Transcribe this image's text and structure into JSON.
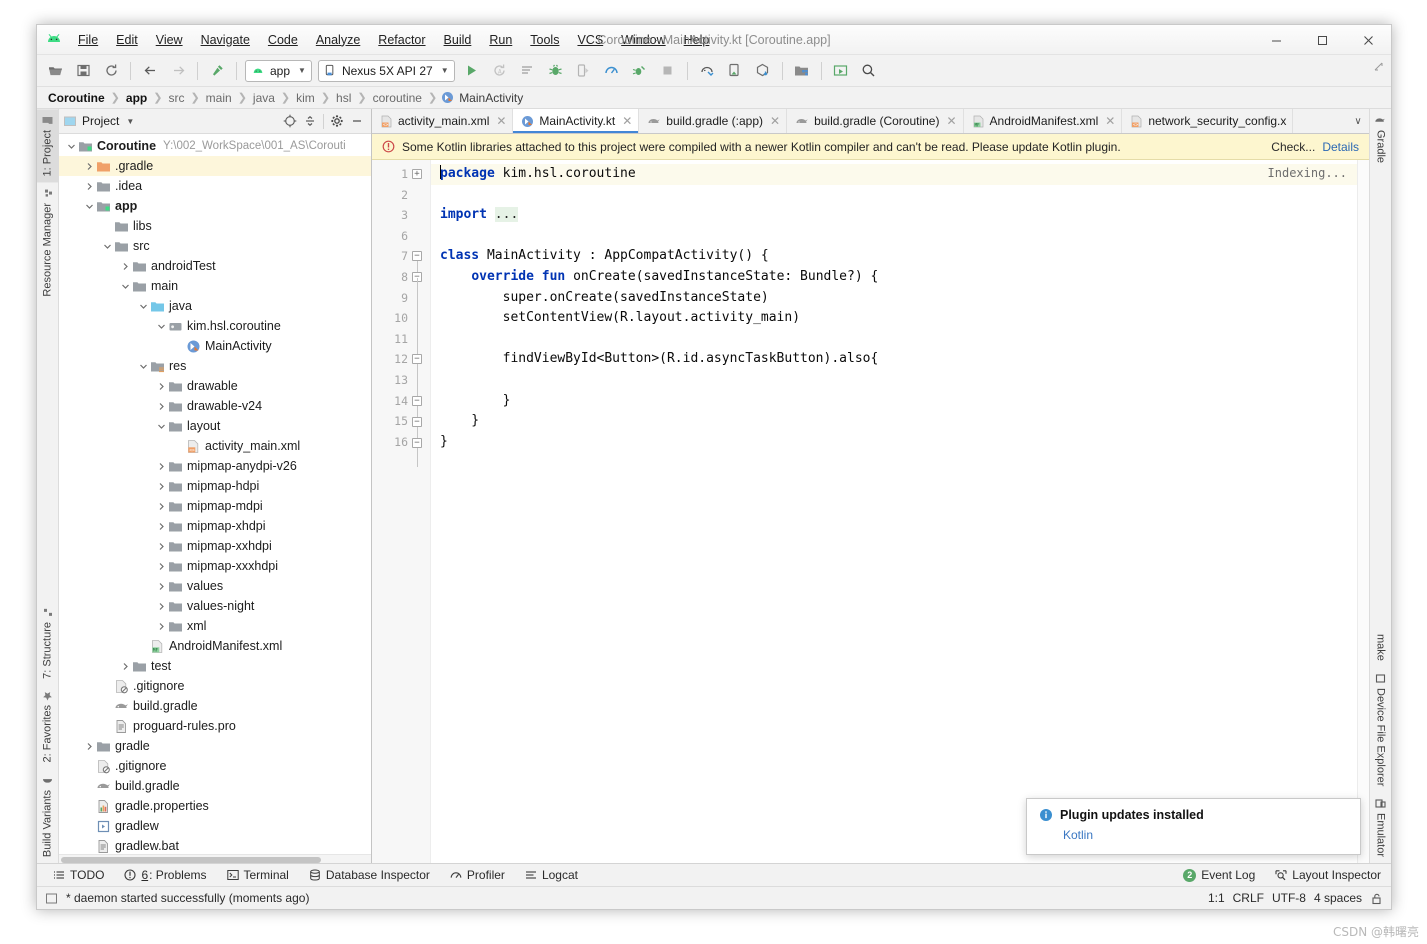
{
  "window": {
    "title": "Coroutine - MainActivity.kt [Coroutine.app]",
    "minimize": "─",
    "maximize": "☐",
    "close": "✕"
  },
  "menubar": [
    {
      "label": "File"
    },
    {
      "label": "Edit"
    },
    {
      "label": "View"
    },
    {
      "label": "Navigate"
    },
    {
      "label": "Code"
    },
    {
      "label": "Analyze"
    },
    {
      "label": "Refactor"
    },
    {
      "label": "Build"
    },
    {
      "label": "Run"
    },
    {
      "label": "Tools"
    },
    {
      "label": "VCS"
    },
    {
      "label": "Window"
    },
    {
      "label": "Help"
    }
  ],
  "toolbar": {
    "module_selector": "app",
    "device_selector": "Nexus 5X API 27",
    "icons": [
      "open-folder-icon",
      "save-all-icon",
      "sync-icon",
      "back-arrow-icon",
      "forward-arrow-icon",
      "build-hammer-icon",
      "run-icon",
      "apply-changes-icon",
      "apply-code-changes-icon",
      "debug-icon",
      "attach-debugger-icon",
      "profiler-icon",
      "run-with-coverage-icon",
      "stop-icon",
      "sdk-manager-icon",
      "avd-manager-icon",
      "sync-project-icon",
      "project-structure-icon",
      "device-manager-icon",
      "search-icon"
    ]
  },
  "breadcrumb": [
    {
      "label": "Coroutine",
      "style": "bold"
    },
    {
      "label": "app",
      "style": "bold"
    },
    {
      "label": "src",
      "style": "dim"
    },
    {
      "label": "main",
      "style": "dim"
    },
    {
      "label": "java",
      "style": "dim"
    },
    {
      "label": "kim",
      "style": "dim"
    },
    {
      "label": "hsl",
      "style": "dim"
    },
    {
      "label": "coroutine",
      "style": "dim"
    },
    {
      "label": "MainActivity",
      "style": "plain",
      "icon": "kotlin-class-icon"
    }
  ],
  "left_strip": {
    "top": [
      {
        "label": "1: Project",
        "icon": "project-icon",
        "active": true
      },
      {
        "label": "Resource Manager",
        "icon": "resource-manager-icon",
        "active": false
      }
    ],
    "bottom": [
      {
        "label": "7: Structure",
        "icon": "structure-icon"
      },
      {
        "label": "2: Favorites",
        "icon": "star-icon"
      },
      {
        "label": "Build Variants",
        "icon": "build-variants-icon"
      }
    ]
  },
  "right_strip": {
    "top": [
      {
        "label": "Gradle",
        "icon": "gradle-elephant-icon"
      }
    ],
    "bottom": [
      {
        "label": "make",
        "icon": ""
      },
      {
        "label": "Device File Explorer",
        "icon": "device-file-explorer-icon"
      },
      {
        "label": "Emulator",
        "icon": "emulator-icon"
      }
    ]
  },
  "project_panel": {
    "title": "Project",
    "header_icons": [
      "target-icon",
      "collapse-all-icon",
      "gear-icon",
      "hide-icon"
    ],
    "tree": [
      {
        "depth": 0,
        "arrow": "down",
        "icon": "module-folder-icon",
        "label": "Coroutine",
        "bold": true,
        "path": "Y:\\002_WorkSpace\\001_AS\\Corouti",
        "selected": false
      },
      {
        "depth": 1,
        "arrow": "right",
        "icon": "excluded-folder-icon",
        "label": ".gradle",
        "bold": false,
        "path": "",
        "selected": true
      },
      {
        "depth": 1,
        "arrow": "right",
        "icon": "folder-icon",
        "label": ".idea",
        "bold": false,
        "path": "",
        "selected": false
      },
      {
        "depth": 1,
        "arrow": "down",
        "icon": "module-folder-icon",
        "label": "app",
        "bold": true,
        "path": "",
        "selected": false
      },
      {
        "depth": 2,
        "arrow": "none",
        "icon": "folder-icon",
        "label": "libs",
        "bold": false,
        "path": "",
        "selected": false
      },
      {
        "depth": 2,
        "arrow": "down",
        "icon": "folder-icon",
        "label": "src",
        "bold": false,
        "path": "",
        "selected": false
      },
      {
        "depth": 3,
        "arrow": "right",
        "icon": "folder-icon",
        "label": "androidTest",
        "bold": false,
        "path": "",
        "selected": false
      },
      {
        "depth": 3,
        "arrow": "down",
        "icon": "folder-icon",
        "label": "main",
        "bold": false,
        "path": "",
        "selected": false
      },
      {
        "depth": 4,
        "arrow": "down",
        "icon": "source-folder-icon",
        "label": "java",
        "bold": false,
        "path": "",
        "selected": false
      },
      {
        "depth": 5,
        "arrow": "down",
        "icon": "package-icon",
        "label": "kim.hsl.coroutine",
        "bold": false,
        "path": "",
        "selected": false
      },
      {
        "depth": 6,
        "arrow": "none",
        "icon": "kotlin-class-icon",
        "label": "MainActivity",
        "bold": false,
        "path": "",
        "selected": false
      },
      {
        "depth": 4,
        "arrow": "down",
        "icon": "res-folder-icon",
        "label": "res",
        "bold": false,
        "path": "",
        "selected": false
      },
      {
        "depth": 5,
        "arrow": "right",
        "icon": "folder-icon",
        "label": "drawable",
        "bold": false,
        "path": "",
        "selected": false
      },
      {
        "depth": 5,
        "arrow": "right",
        "icon": "folder-icon",
        "label": "drawable-v24",
        "bold": false,
        "path": "",
        "selected": false
      },
      {
        "depth": 5,
        "arrow": "down",
        "icon": "folder-icon",
        "label": "layout",
        "bold": false,
        "path": "",
        "selected": false
      },
      {
        "depth": 6,
        "arrow": "none",
        "icon": "layout-xml-icon",
        "label": "activity_main.xml",
        "bold": false,
        "path": "",
        "selected": false
      },
      {
        "depth": 5,
        "arrow": "right",
        "icon": "folder-icon",
        "label": "mipmap-anydpi-v26",
        "bold": false,
        "path": "",
        "selected": false
      },
      {
        "depth": 5,
        "arrow": "right",
        "icon": "folder-icon",
        "label": "mipmap-hdpi",
        "bold": false,
        "path": "",
        "selected": false
      },
      {
        "depth": 5,
        "arrow": "right",
        "icon": "folder-icon",
        "label": "mipmap-mdpi",
        "bold": false,
        "path": "",
        "selected": false
      },
      {
        "depth": 5,
        "arrow": "right",
        "icon": "folder-icon",
        "label": "mipmap-xhdpi",
        "bold": false,
        "path": "",
        "selected": false
      },
      {
        "depth": 5,
        "arrow": "right",
        "icon": "folder-icon",
        "label": "mipmap-xxhdpi",
        "bold": false,
        "path": "",
        "selected": false
      },
      {
        "depth": 5,
        "arrow": "right",
        "icon": "folder-icon",
        "label": "mipmap-xxxhdpi",
        "bold": false,
        "path": "",
        "selected": false
      },
      {
        "depth": 5,
        "arrow": "right",
        "icon": "folder-icon",
        "label": "values",
        "bold": false,
        "path": "",
        "selected": false
      },
      {
        "depth": 5,
        "arrow": "right",
        "icon": "folder-icon",
        "label": "values-night",
        "bold": false,
        "path": "",
        "selected": false
      },
      {
        "depth": 5,
        "arrow": "right",
        "icon": "folder-icon",
        "label": "xml",
        "bold": false,
        "path": "",
        "selected": false
      },
      {
        "depth": 4,
        "arrow": "none",
        "icon": "manifest-xml-icon",
        "label": "AndroidManifest.xml",
        "bold": false,
        "path": "",
        "selected": false
      },
      {
        "depth": 3,
        "arrow": "right",
        "icon": "folder-icon",
        "label": "test",
        "bold": false,
        "path": "",
        "selected": false
      },
      {
        "depth": 2,
        "arrow": "none",
        "icon": "gitignore-icon",
        "label": ".gitignore",
        "bold": false,
        "path": "",
        "selected": false
      },
      {
        "depth": 2,
        "arrow": "none",
        "icon": "gradle-file-icon",
        "label": "build.gradle",
        "bold": false,
        "path": "",
        "selected": false
      },
      {
        "depth": 2,
        "arrow": "none",
        "icon": "text-file-icon",
        "label": "proguard-rules.pro",
        "bold": false,
        "path": "",
        "selected": false
      },
      {
        "depth": 1,
        "arrow": "right",
        "icon": "folder-icon",
        "label": "gradle",
        "bold": false,
        "path": "",
        "selected": false
      },
      {
        "depth": 1,
        "arrow": "none",
        "icon": "gitignore-icon",
        "label": ".gitignore",
        "bold": false,
        "path": "",
        "selected": false
      },
      {
        "depth": 1,
        "arrow": "none",
        "icon": "gradle-file-icon",
        "label": "build.gradle",
        "bold": false,
        "path": "",
        "selected": false
      },
      {
        "depth": 1,
        "arrow": "none",
        "icon": "properties-icon",
        "label": "gradle.properties",
        "bold": false,
        "path": "",
        "selected": false
      },
      {
        "depth": 1,
        "arrow": "none",
        "icon": "script-icon",
        "label": "gradlew",
        "bold": false,
        "path": "",
        "selected": false
      },
      {
        "depth": 1,
        "arrow": "none",
        "icon": "text-file-icon",
        "label": "gradlew.bat",
        "bold": false,
        "path": "",
        "selected": false
      }
    ]
  },
  "editor": {
    "tabs": [
      {
        "label": "activity_main.xml",
        "icon": "layout-xml-icon",
        "active": false
      },
      {
        "label": "MainActivity.kt",
        "icon": "kotlin-class-icon",
        "active": true
      },
      {
        "label": "build.gradle (:app)",
        "icon": "gradle-file-icon",
        "active": false
      },
      {
        "label": "build.gradle (Coroutine)",
        "icon": "gradle-file-icon",
        "active": false
      },
      {
        "label": "AndroidManifest.xml",
        "icon": "manifest-xml-icon",
        "active": false
      },
      {
        "label": "network_security_config.x",
        "icon": "layout-xml-icon",
        "active": false
      }
    ],
    "tabs_overflow": "∨",
    "notification": {
      "icon": "error-icon",
      "text": "Some Kotlin libraries attached to this project were compiled with a newer Kotlin compiler and can't be read. Please update Kotlin plugin.",
      "action": "Check...",
      "link": "Details"
    },
    "status_overlay": "Indexing...",
    "line_numbers": [
      1,
      2,
      3,
      6,
      7,
      8,
      9,
      10,
      11,
      12,
      13,
      14,
      15,
      16
    ],
    "code_lines": [
      {
        "n": 1,
        "text": "package kim.hsl.coroutine",
        "highlight": true,
        "caret": true
      },
      {
        "n": 2,
        "text": "",
        "highlight": false
      },
      {
        "n": 3,
        "text": "import ...",
        "highlight": false,
        "fold": true
      },
      {
        "n": 6,
        "text": "",
        "highlight": false
      },
      {
        "n": 7,
        "text": "class MainActivity : AppCompatActivity() {",
        "highlight": false
      },
      {
        "n": 8,
        "text": "    override fun onCreate(savedInstanceState: Bundle?) {",
        "highlight": false
      },
      {
        "n": 9,
        "text": "        super.onCreate(savedInstanceState)",
        "highlight": false
      },
      {
        "n": 10,
        "text": "        setContentView(R.layout.activity_main)",
        "highlight": false
      },
      {
        "n": 11,
        "text": "",
        "highlight": false
      },
      {
        "n": 12,
        "text": "        findViewById<Button>(R.id.asyncTaskButton).also{",
        "highlight": false
      },
      {
        "n": 13,
        "text": "",
        "highlight": false
      },
      {
        "n": 14,
        "text": "        }",
        "highlight": false
      },
      {
        "n": 15,
        "text": "    }",
        "highlight": false
      },
      {
        "n": 16,
        "text": "}",
        "highlight": false
      }
    ]
  },
  "popup": {
    "icon": "info-icon",
    "title": "Plugin updates installed",
    "link": "Kotlin"
  },
  "bottom_strip": [
    {
      "label": "TODO",
      "icon": "todo-icon",
      "mnemonic": ""
    },
    {
      "label": ": Problems",
      "icon": "problems-icon",
      "mnemonic": "6"
    },
    {
      "label": "Terminal",
      "icon": "terminal-icon",
      "mnemonic": ""
    },
    {
      "label": "Database Inspector",
      "icon": "database-icon",
      "mnemonic": ""
    },
    {
      "label": "Profiler",
      "icon": "profiler-icon",
      "mnemonic": ""
    },
    {
      "label": "Logcat",
      "icon": "logcat-icon",
      "mnemonic": ""
    }
  ],
  "bottom_strip_right": [
    {
      "label": "Event Log",
      "icon": "event-log-icon",
      "badge": "2"
    },
    {
      "label": "Layout Inspector",
      "icon": "layout-inspector-icon",
      "badge": ""
    }
  ],
  "statusbar": {
    "message": "* daemon started successfully (moments ago)",
    "caret_position": "1:1",
    "line_separator": "CRLF",
    "encoding": "UTF-8",
    "indent": "4 spaces",
    "lock_icon": "unlocked-icon"
  },
  "watermark": "CSDN @韩曙亮",
  "colors": {
    "accent_blue": "#4387d6",
    "keyword_blue": "#0033b3",
    "warning_bg": "#fdf6cf",
    "selection_yellow": "#fdf6db",
    "android_green": "#3ddc84",
    "fold_green": "#e6f2e6"
  }
}
